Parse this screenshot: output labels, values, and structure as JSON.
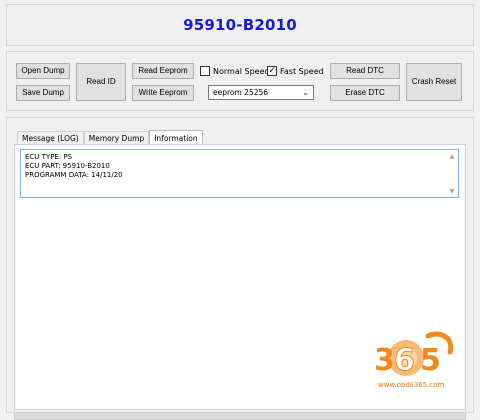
{
  "header": {
    "title": "95910-B2010"
  },
  "toolbar": {
    "open_dump": "Open Dump",
    "save_dump": "Save Dump",
    "read_id": "Read ID",
    "read_eeprom": "Read Eeprom",
    "write_eeprom": "Write Eeprom",
    "normal_speed": "Normal Speed",
    "fast_speed": "Fast Speed",
    "normal_speed_checked": false,
    "fast_speed_checked": true,
    "eeprom_selected": "eeprom 25256",
    "read_dtc": "Read DTC",
    "erase_dtc": "Erase DTC",
    "crash_reset": "Crash Reset"
  },
  "tabs": [
    {
      "label": "Message (LOG)",
      "active": false
    },
    {
      "label": "Memory Dump",
      "active": false
    },
    {
      "label": "Information",
      "active": true
    }
  ],
  "info": {
    "lines": [
      "ECU TYPE:  PS",
      "ECU PART:  95910-B2010",
      "PROGRAMM DATA:  14/11/20"
    ]
  },
  "watermark": {
    "logo_text": "365",
    "url": "www.obdii365.com",
    "accent_color": "#f08a1c"
  }
}
